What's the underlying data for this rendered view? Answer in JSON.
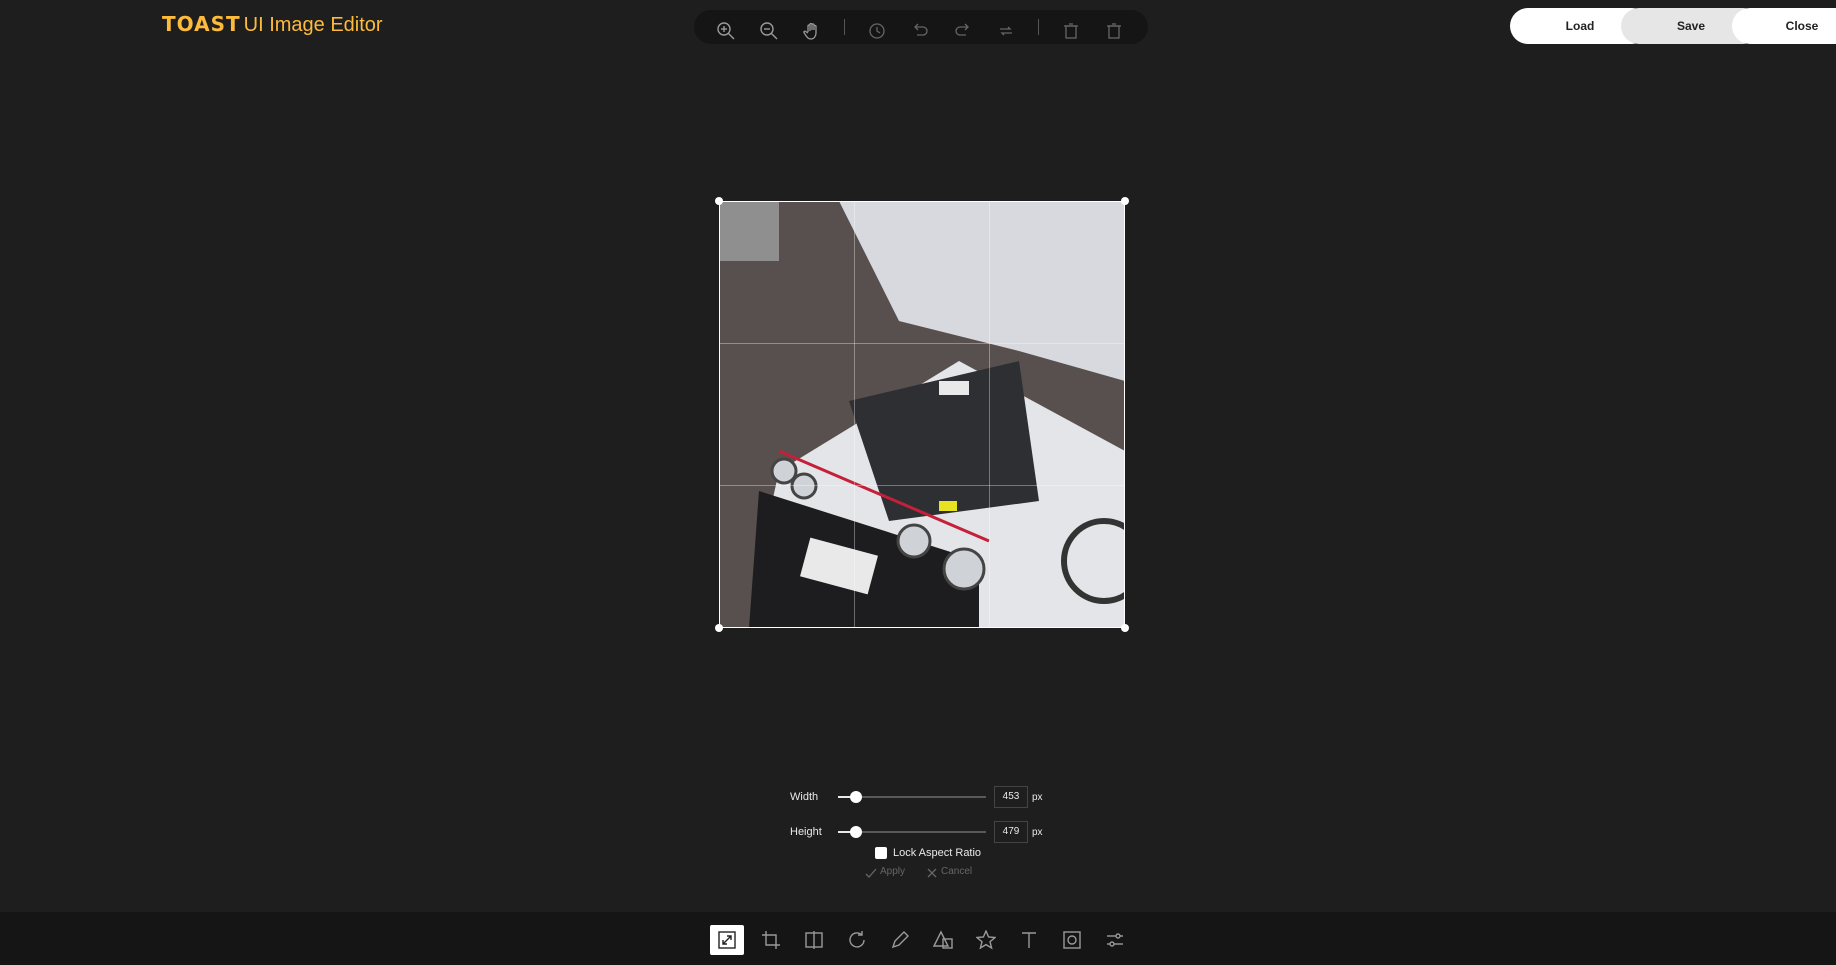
{
  "app": {
    "brand": "TOAST",
    "title_rest": "UI Image Editor"
  },
  "header": {
    "load_label": "Load",
    "save_label": "Save",
    "close_label": "Close"
  },
  "top_menu": {
    "items": [
      "zoom-in-icon",
      "zoom-out-icon",
      "hand-icon",
      "history-icon",
      "undo-icon",
      "redo-icon",
      "reset-icon",
      "delete-icon",
      "delete-all-icon"
    ]
  },
  "resize": {
    "width_label": "Width",
    "width_value": "453",
    "width_unit": "px",
    "width_level": 0.12,
    "height_label": "Height",
    "height_value": "479",
    "height_unit": "px",
    "height_level": 0.12,
    "lock_label": "Lock Aspect Ratio",
    "lock_checked": false,
    "apply_label": "Apply",
    "cancel_label": "Cancel"
  },
  "bottom_tools": [
    "resize",
    "crop",
    "flip",
    "rotate",
    "draw",
    "shape",
    "icon",
    "text",
    "mask",
    "filter"
  ],
  "active_tool": "resize",
  "colors": {
    "background": "#1e1e1e",
    "bar": "#151515",
    "brand": "#fdba3b"
  }
}
